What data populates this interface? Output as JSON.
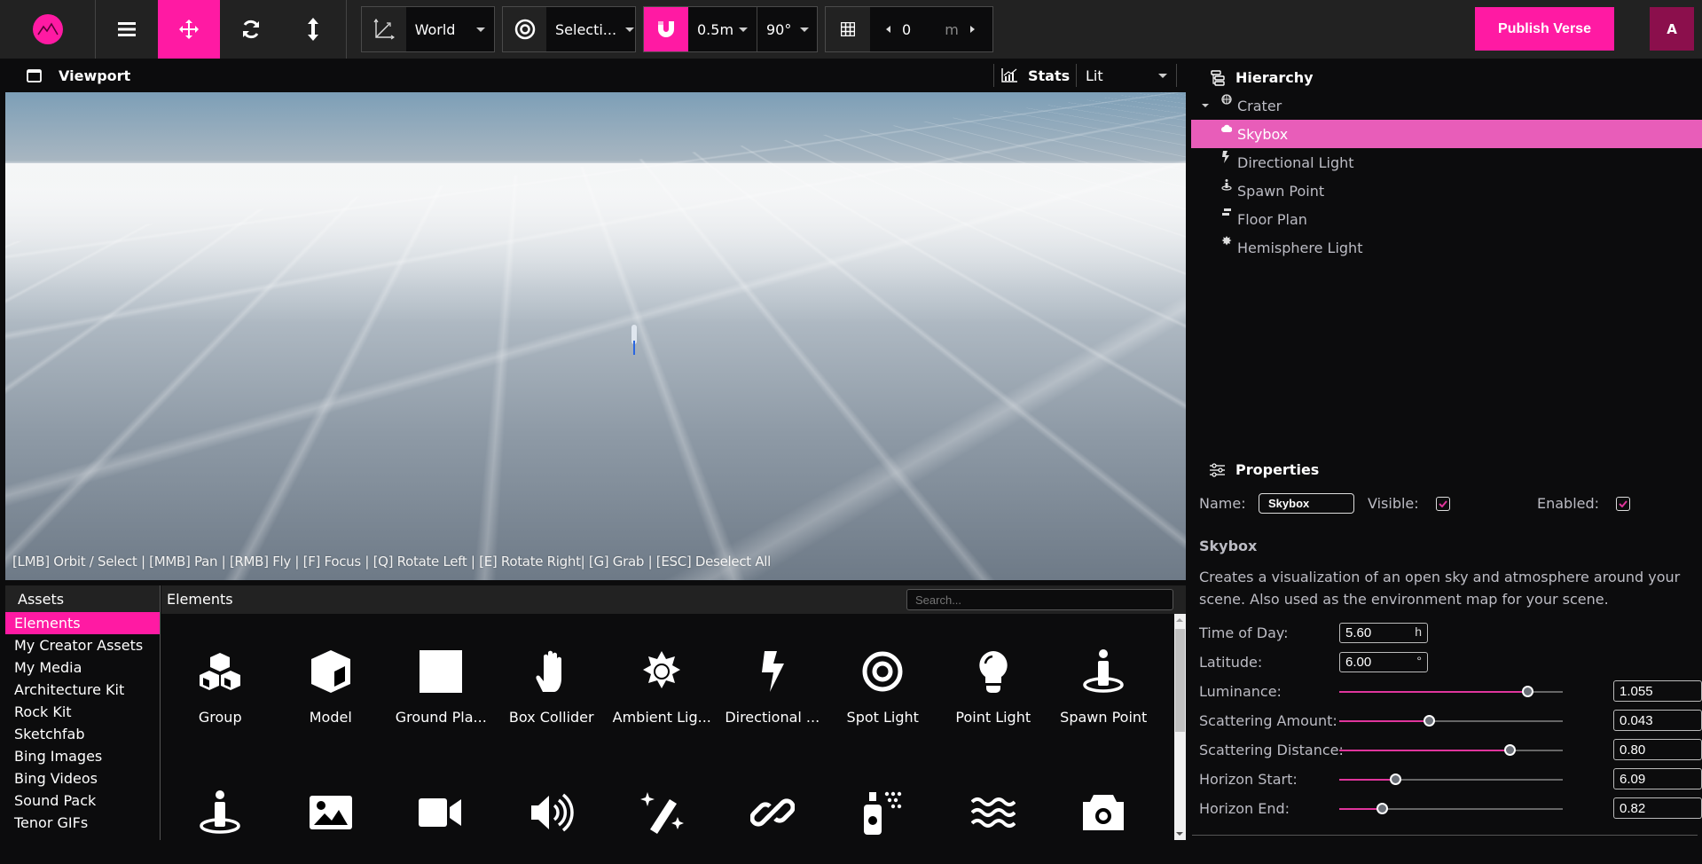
{
  "toolbar": {
    "logo": "app-logo",
    "tools": [
      {
        "name": "menu",
        "icon": "hamburger-icon",
        "active": false
      },
      {
        "name": "move",
        "icon": "move-arrows-icon",
        "active": true
      },
      {
        "name": "rotate",
        "icon": "rotate-icon",
        "active": false
      },
      {
        "name": "scale",
        "icon": "vertical-arrows-icon",
        "active": false
      }
    ],
    "space_select": "World",
    "pivot_select": "Selecti...",
    "snap_distance": "0.5m",
    "snap_angle": "90°",
    "grid_value": "0",
    "grid_unit": "m",
    "publish_label": "Publish Verse",
    "avatar_initial": "A",
    "accent_color": "#ff1aa3"
  },
  "viewport": {
    "title": "Viewport",
    "stats_label": "Stats",
    "render_mode": "Lit",
    "hint": "[LMB] Orbit / Select | [MMB] Pan | [RMB] Fly | [F] Focus | [Q] Rotate Left | [E] Rotate Right| [G] Grab | [ESC] Deselect All"
  },
  "assets": {
    "header": "Assets",
    "items": [
      "Elements",
      "My Creator Assets",
      "My Media",
      "Architecture Kit",
      "Rock Kit",
      "Sketchfab",
      "Bing Images",
      "Bing Videos",
      "Sound Pack",
      "Tenor GIFs"
    ],
    "active_index": 0
  },
  "elements": {
    "header": "Elements",
    "search_placeholder": "Search...",
    "tiles": [
      {
        "label": "Group",
        "icon": "cubes-icon"
      },
      {
        "label": "Model",
        "icon": "cube-icon"
      },
      {
        "label": "Ground Pla...",
        "icon": "square-icon"
      },
      {
        "label": "Box Collider",
        "icon": "hand-icon"
      },
      {
        "label": "Ambient Lig...",
        "icon": "sun-icon"
      },
      {
        "label": "Directional ...",
        "icon": "bolt-icon"
      },
      {
        "label": "Spot Light",
        "icon": "target-icon"
      },
      {
        "label": "Point Light",
        "icon": "lightbulb-icon"
      },
      {
        "label": "Spawn Point",
        "icon": "spawn-person-icon"
      },
      {
        "label": "",
        "icon": "spawn-person-icon"
      },
      {
        "label": "",
        "icon": "image-icon"
      },
      {
        "label": "",
        "icon": "video-camera-icon"
      },
      {
        "label": "",
        "icon": "volume-icon"
      },
      {
        "label": "",
        "icon": "magic-wand-icon"
      },
      {
        "label": "",
        "icon": "link-icon"
      },
      {
        "label": "",
        "icon": "spray-can-icon"
      },
      {
        "label": "",
        "icon": "water-icon"
      },
      {
        "label": "",
        "icon": "camera-icon"
      }
    ]
  },
  "hierarchy": {
    "title": "Hierarchy",
    "root": {
      "label": "Crater",
      "icon": "globe-icon"
    },
    "children": [
      {
        "label": "Skybox",
        "icon": "cloud-icon",
        "selected": true
      },
      {
        "label": "Directional Light",
        "icon": "bolt-icon",
        "selected": false
      },
      {
        "label": "Spawn Point",
        "icon": "spawn-person-icon",
        "selected": false
      },
      {
        "label": "Floor Plan",
        "icon": "signs-icon",
        "selected": false
      },
      {
        "label": "Hemisphere Light",
        "icon": "sun-icon",
        "selected": false
      }
    ]
  },
  "properties": {
    "title": "Properties",
    "name_label": "Name:",
    "name_value": "Skybox",
    "visible_label": "Visible:",
    "visible": true,
    "enabled_label": "Enabled:",
    "enabled": true,
    "component_title": "Skybox",
    "description": "Creates a visualization of an open sky and atmosphere around your scene. Also used as the environment map for your scene.",
    "time_of_day": {
      "label": "Time of Day:",
      "value": "5.60",
      "unit": "h"
    },
    "latitude": {
      "label": "Latitude:",
      "value": "6.00",
      "unit": "°"
    },
    "sliders": [
      {
        "label": "Luminance:",
        "value": "1.055",
        "fraction": 0.84
      },
      {
        "label": "Scattering Amount:",
        "value": "0.043",
        "fraction": 0.4
      },
      {
        "label": "Scattering Distance:",
        "value": "0.80",
        "fraction": 0.76
      },
      {
        "label": "Horizon Start:",
        "value": "6.09",
        "fraction": 0.25
      },
      {
        "label": "Horizon End:",
        "value": "0.82",
        "fraction": 0.19
      }
    ]
  }
}
